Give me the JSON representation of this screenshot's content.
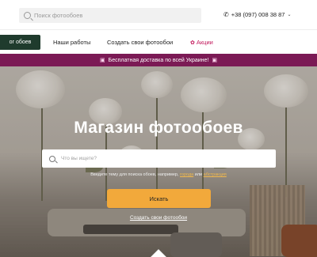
{
  "header": {
    "search_placeholder": "Поиск фотообоев",
    "phone": "+38 (097) 008 38 87"
  },
  "nav": {
    "catalog": "ог обоев",
    "works": "Наши работы",
    "create": "Создать свои фотообои",
    "sale": "Акции"
  },
  "promo": {
    "text": "Бесплатная доставка по всей Украине!"
  },
  "hero": {
    "title": "Магазин фотообоев",
    "search_placeholder": "Что вы ищете?",
    "hint_prefix": "Введите тему для поиска обоев, например,",
    "hint_link1": "города",
    "hint_or": "или",
    "hint_link2": "абстракция",
    "button": "Искать",
    "create_link": "Создать свои фотообои"
  },
  "icons": {
    "search": "search-icon",
    "phone": "phone-icon",
    "chevron": "chevron-down-icon",
    "tag": "tag-icon",
    "gift": "gift-icon"
  },
  "colors": {
    "catalog_bg": "#1f3b2d",
    "promo_bg": "#7b1a55",
    "sale_text": "#c2185b",
    "button_bg": "#f2a93b"
  }
}
